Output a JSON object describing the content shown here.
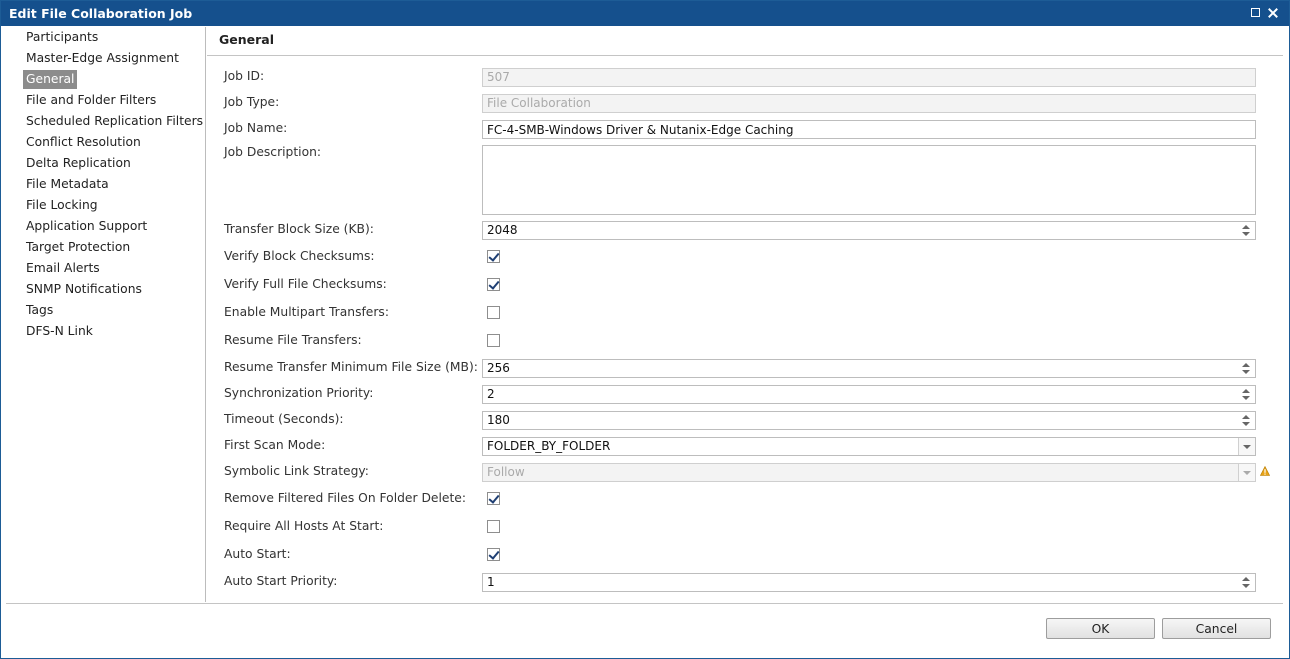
{
  "window": {
    "title": "Edit File Collaboration Job"
  },
  "nav": {
    "items": [
      "Participants",
      "Master-Edge Assignment",
      "General",
      "File and Folder Filters",
      "Scheduled Replication Filters",
      "Conflict Resolution",
      "Delta Replication",
      "File Metadata",
      "File Locking",
      "Application Support",
      "Target Protection",
      "Email Alerts",
      "SNMP Notifications",
      "Tags",
      "DFS-N Link"
    ],
    "selected": "General"
  },
  "panel": {
    "title": "General"
  },
  "form": {
    "job_id": {
      "label": "Job ID:",
      "value": "507"
    },
    "job_type": {
      "label": "Job Type:",
      "value": "File Collaboration"
    },
    "job_name": {
      "label": "Job Name:",
      "value": "FC-4-SMB-Windows Driver & Nutanix-Edge Caching"
    },
    "job_description": {
      "label": "Job Description:",
      "value": ""
    },
    "transfer_block_size": {
      "label": "Transfer Block Size (KB):",
      "value": "2048"
    },
    "verify_block_checksums": {
      "label": "Verify Block Checksums:",
      "checked": true
    },
    "verify_full_file_checksums": {
      "label": "Verify Full File Checksums:",
      "checked": true
    },
    "enable_multipart_transfers": {
      "label": "Enable Multipart Transfers:",
      "checked": false
    },
    "resume_file_transfers": {
      "label": "Resume File Transfers:",
      "checked": false
    },
    "resume_min_file_size": {
      "label": "Resume Transfer Minimum File Size (MB):",
      "value": "256"
    },
    "synchronization_priority": {
      "label": "Synchronization Priority:",
      "value": "2"
    },
    "timeout": {
      "label": "Timeout (Seconds):",
      "value": "180"
    },
    "first_scan_mode": {
      "label": "First Scan Mode:",
      "value": "FOLDER_BY_FOLDER"
    },
    "symbolic_link_strategy": {
      "label": "Symbolic Link Strategy:",
      "value": "Follow"
    },
    "remove_filtered_files": {
      "label": "Remove Filtered Files On Folder Delete:",
      "checked": true
    },
    "require_all_hosts": {
      "label": "Require All Hosts At Start:",
      "checked": false
    },
    "auto_start": {
      "label": "Auto Start:",
      "checked": true
    },
    "auto_start_priority": {
      "label": "Auto Start Priority:",
      "value": "1"
    }
  },
  "buttons": {
    "ok": "OK",
    "cancel": "Cancel"
  },
  "colors": {
    "titlebar": "#15508d",
    "nav_selected": "#8c8c8c",
    "warning": "#e8a317"
  },
  "icons": {
    "warning": "warning-icon",
    "maximize": "maximize-icon",
    "close": "close-icon"
  }
}
